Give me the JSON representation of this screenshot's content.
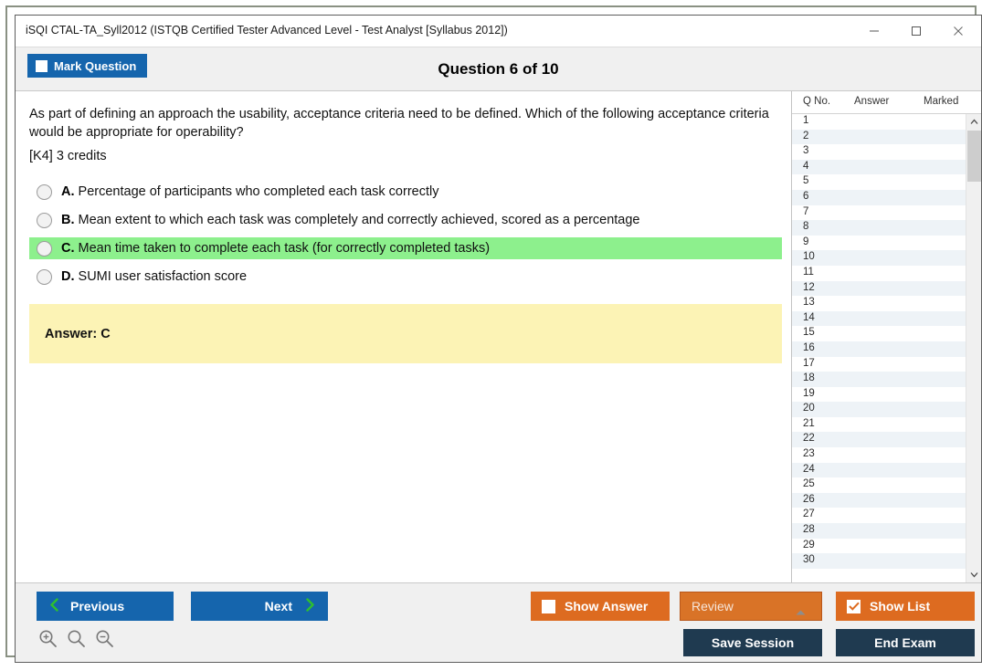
{
  "window": {
    "title": "iSQI CTAL-TA_Syll2012 (ISTQB Certified Tester Advanced Level - Test Analyst [Syllabus 2012])",
    "minimize_label": "Minimize",
    "maximize_label": "Maximize",
    "close_label": "Close"
  },
  "header": {
    "mark_question_label": "Mark Question",
    "mark_question_checked": false,
    "question_counter": "Question 6 of 10"
  },
  "question": {
    "text": "As part of defining an approach the usability, acceptance criteria need to be defined. Which of the following acceptance criteria would be appropriate for operability?",
    "credits": "[K4] 3 credits",
    "options": [
      {
        "letter": "A.",
        "text": "Percentage of participants who completed each task correctly",
        "highlighted": false,
        "selected": false
      },
      {
        "letter": "B.",
        "text": "Mean extent to which each task was completely and correctly achieved, scored as a percentage",
        "highlighted": false,
        "selected": false
      },
      {
        "letter": "C.",
        "text": "Mean time taken to complete each task (for correctly completed tasks)",
        "highlighted": true,
        "selected": false
      },
      {
        "letter": "D.",
        "text": "SUMI user satisfaction score",
        "highlighted": false,
        "selected": false
      }
    ],
    "answer_label": "Answer: C"
  },
  "list_panel": {
    "columns": [
      "Q No.",
      "Answer",
      "Marked"
    ],
    "rows": [
      {
        "qno": "1",
        "answer": "",
        "marked": ""
      },
      {
        "qno": "2",
        "answer": "",
        "marked": ""
      },
      {
        "qno": "3",
        "answer": "",
        "marked": ""
      },
      {
        "qno": "4",
        "answer": "",
        "marked": ""
      },
      {
        "qno": "5",
        "answer": "",
        "marked": ""
      },
      {
        "qno": "6",
        "answer": "",
        "marked": ""
      },
      {
        "qno": "7",
        "answer": "",
        "marked": ""
      },
      {
        "qno": "8",
        "answer": "",
        "marked": ""
      },
      {
        "qno": "9",
        "answer": "",
        "marked": ""
      },
      {
        "qno": "10",
        "answer": "",
        "marked": ""
      },
      {
        "qno": "11",
        "answer": "",
        "marked": ""
      },
      {
        "qno": "12",
        "answer": "",
        "marked": ""
      },
      {
        "qno": "13",
        "answer": "",
        "marked": ""
      },
      {
        "qno": "14",
        "answer": "",
        "marked": ""
      },
      {
        "qno": "15",
        "answer": "",
        "marked": ""
      },
      {
        "qno": "16",
        "answer": "",
        "marked": ""
      },
      {
        "qno": "17",
        "answer": "",
        "marked": ""
      },
      {
        "qno": "18",
        "answer": "",
        "marked": ""
      },
      {
        "qno": "19",
        "answer": "",
        "marked": ""
      },
      {
        "qno": "20",
        "answer": "",
        "marked": ""
      },
      {
        "qno": "21",
        "answer": "",
        "marked": ""
      },
      {
        "qno": "22",
        "answer": "",
        "marked": ""
      },
      {
        "qno": "23",
        "answer": "",
        "marked": ""
      },
      {
        "qno": "24",
        "answer": "",
        "marked": ""
      },
      {
        "qno": "25",
        "answer": "",
        "marked": ""
      },
      {
        "qno": "26",
        "answer": "",
        "marked": ""
      },
      {
        "qno": "27",
        "answer": "",
        "marked": ""
      },
      {
        "qno": "28",
        "answer": "",
        "marked": ""
      },
      {
        "qno": "29",
        "answer": "",
        "marked": ""
      },
      {
        "qno": "30",
        "answer": "",
        "marked": ""
      }
    ]
  },
  "footer": {
    "previous_label": "Previous",
    "next_label": "Next",
    "show_answer_label": "Show Answer",
    "show_answer_checked": false,
    "review_label": "Review",
    "show_list_label": "Show List",
    "show_list_checked": true,
    "save_session_label": "Save Session",
    "end_exam_label": "End Exam",
    "zoom_in_label": "Zoom In",
    "zoom_reset_label": "Zoom Reset",
    "zoom_out_label": "Zoom Out"
  },
  "colors": {
    "primary_blue": "#1565ad",
    "accent_orange": "#dd6b20",
    "navy": "#1f3a50",
    "highlight_green": "#8df08d",
    "answer_yellow": "#fcf3b5",
    "chevron_green": "#2fbf2f"
  }
}
